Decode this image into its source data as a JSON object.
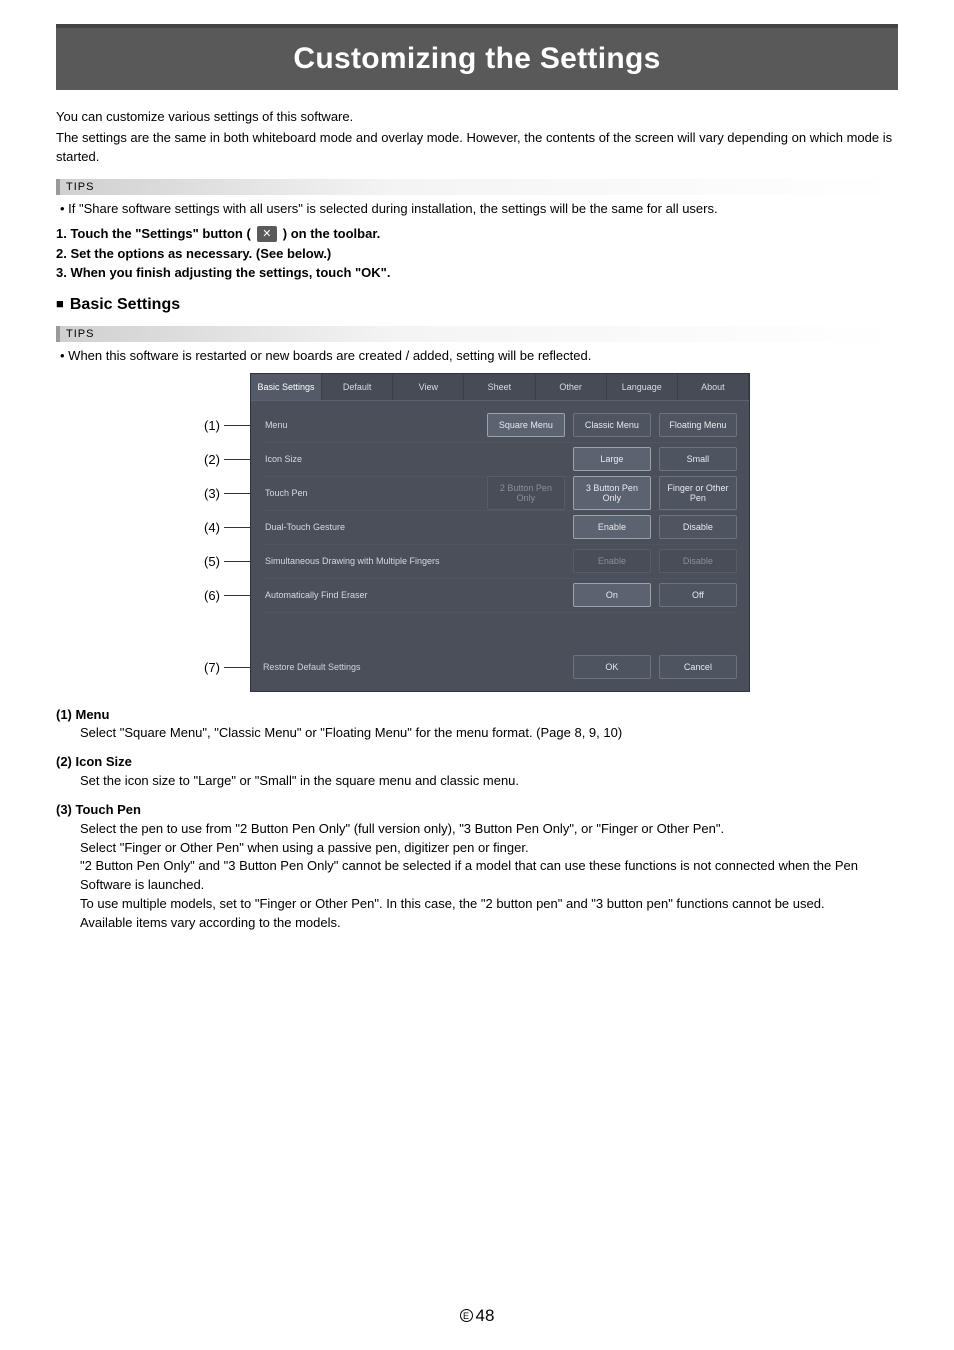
{
  "title": "Customizing the Settings",
  "intro_1": "You can customize various settings of this software.",
  "intro_2": "The settings are the same in both whiteboard mode and overlay mode. However, the contents of the screen will vary depending on which mode is started.",
  "tips_label": "TIPS",
  "tips_1": "If \"Share software settings with all users\" is selected during installation, the settings will be the same for all users.",
  "step1_a": "1. Touch the \"Settings\" button (",
  "step1_b": ") on the toolbar.",
  "step2": "2. Set the options as necessary. (See below.)",
  "step3": "3. When you finish adjusting the settings, touch \"OK\".",
  "section_basic": "Basic Settings",
  "tips_2": "When this software is restarted or new boards are created / added, setting will be reflected.",
  "callouts": [
    "(1)",
    "(2)",
    "(3)",
    "(4)",
    "(5)",
    "(6)",
    "(7)"
  ],
  "dialog": {
    "tabs": [
      "Basic Settings",
      "Default",
      "View",
      "Sheet",
      "Other",
      "Language",
      "About"
    ],
    "rows": {
      "menu": {
        "label": "Menu",
        "opts": [
          "Square Menu",
          "Classic Menu",
          "Floating Menu"
        ]
      },
      "icon": {
        "label": "Icon Size",
        "opts": [
          "Large",
          "Small"
        ]
      },
      "pen": {
        "label": "Touch Pen",
        "opts": [
          "2 Button Pen Only",
          "3 Button Pen Only",
          "Finger or Other Pen"
        ]
      },
      "gesture": {
        "label": "Dual-Touch Gesture",
        "opts": [
          "Enable",
          "Disable"
        ]
      },
      "multi": {
        "label": "Simultaneous Drawing with Multiple Fingers",
        "opts": [
          "Enable",
          "Disable"
        ]
      },
      "eraser": {
        "label": "Automatically Find Eraser",
        "opts": [
          "On",
          "Off"
        ]
      }
    },
    "restore": "Restore Default Settings",
    "ok": "OK",
    "cancel": "Cancel"
  },
  "desc": {
    "d1h": "(1) Menu",
    "d1b": "Select \"Square Menu\", \"Classic Menu\" or \"Floating Menu\" for the menu format. (Page 8, 9, 10)",
    "d2h": "(2) Icon Size",
    "d2b": "Set the icon size to \"Large\" or \"Small\" in the square menu and classic menu.",
    "d3h": "(3) Touch Pen",
    "d3b1": "Select the pen to use from \"2 Button Pen Only\" (full version only), \"3 Button Pen Only\", or \"Finger or Other Pen\".",
    "d3b2": "Select \"Finger or Other Pen\" when using a passive pen, digitizer pen or finger.",
    "d3b3": "\"2 Button Pen Only\" and \"3 Button Pen Only\" cannot be selected if a model that can use these functions is not connected when the Pen Software is launched.",
    "d3b4": "To use multiple models, set to \"Finger or Other Pen\". In this case, the \"2 button pen\" and \"3 button pen\" functions cannot be used.",
    "d3b5": "Available items vary according to the models."
  },
  "page_num": "48"
}
